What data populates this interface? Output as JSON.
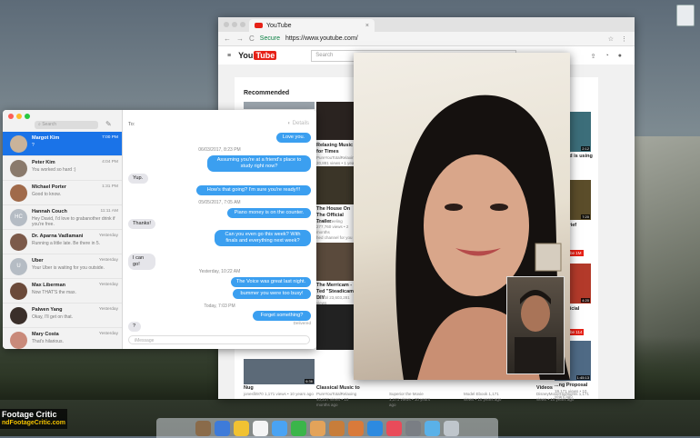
{
  "browser": {
    "tab_title": "YouTube",
    "tab_close": "×",
    "secure_label": "Secure",
    "url": "https://www.youtube.com/",
    "nav_back": "←",
    "nav_forward": "→",
    "nav_reload": "C",
    "star": "☆",
    "menu": "⋮"
  },
  "youtube": {
    "logo_you": "You",
    "logo_tube": "Tube",
    "menu": "≡",
    "search_placeholder": "Search",
    "section_title": "Recommended",
    "videos": [
      {
        "title": "Relaxing Music for Times",
        "meta": "PureYouTotalRelaxing 20,881 views • 1 year ago",
        "duration": ""
      },
      {
        "title": "The House On The Official Trailer",
        "meta": "Austin Keeling 277,760 views • 2 months",
        "duration": ""
      },
      {
        "title": "The Merricam - Ted \"Steadicam\" DIY",
        "meta": "Rambl 23,603,281 views",
        "duration": ""
      },
      {
        "title": "Nug",
        "meta": "jonesfit970 1,171 views • 10 years ago",
        "duration": "6:36"
      },
      {
        "title": "Classical Music to",
        "meta": "PureYouTotalRelaxing 40,237 views • 10 months ago",
        "duration": ""
      },
      {
        "title": "",
        "meta": "Superior the Movie 1,171 views • 10 years ago",
        "duration": ""
      },
      {
        "title": "",
        "meta": "Model Ebook 1,171 views • 10 years ago",
        "duration": ""
      },
      {
        "title": "Videos",
        "meta": "DisneyMovieHighlights 1,171 views • 10 years ago",
        "duration": ""
      },
      {
        "title": "Proposal",
        "meta": "19,171 views • 10 years ago",
        "duration": "1:45:13"
      }
    ],
    "side_titles": [
      "...ur kid is using",
      "...of Grief",
      "...\" Official",
      "...ng Proposal"
    ],
    "side_durations": [
      "2:12",
      "7:20",
      "4:20"
    ],
    "subscribe_label": "Subscribe",
    "subscribe_count_1": "1M",
    "subscribe_count_2": "114",
    "channel_note": "hed channel for you"
  },
  "messages": {
    "search_placeholder": "Search",
    "compose_icon": "✎",
    "to_label": "To:",
    "input_placeholder": "iMessage",
    "conversations": [
      {
        "name": "Margot Kim",
        "time": "7:00 PM",
        "preview": "?",
        "initials": ""
      },
      {
        "name": "Peter Kim",
        "time": "4:04 PM",
        "preview": "You worked so hard :)",
        "initials": ""
      },
      {
        "name": "Michael Porter",
        "time": "1:31 PM",
        "preview": "Good to know.",
        "initials": ""
      },
      {
        "name": "Hannah Couch",
        "time": "11:11 AM",
        "preview": "Hey David, I'd love to grabanother drink if you're free.",
        "initials": "HC"
      },
      {
        "name": "Dr. Aparna Vadlamani",
        "time": "Yesterday",
        "preview": "Running a little late. Be there in 5.",
        "initials": ""
      },
      {
        "name": "Uber",
        "time": "Yesterday",
        "preview": "Your Uber is waiting for you outside.",
        "initials": "U"
      },
      {
        "name": "Max Liberman",
        "time": "Yesterday",
        "preview": "Now THAT'S the max.",
        "initials": ""
      },
      {
        "name": "Palwen Yang",
        "time": "Yesterday",
        "preview": "Okay, I'll get on that.",
        "initials": ""
      },
      {
        "name": "Mary Costa",
        "time": "Yesterday",
        "preview": "That's hilarious.",
        "initials": ""
      }
    ],
    "thread": [
      {
        "kind": "out",
        "text": "Love you."
      },
      {
        "kind": "ts",
        "text": "06/03/2017, 8:23 PM"
      },
      {
        "kind": "out",
        "text": "Assuming you're at a friend's place to study right now?"
      },
      {
        "kind": "in",
        "text": "Yup."
      },
      {
        "kind": "out",
        "text": "How's that going? I'm sure you're ready!!!"
      },
      {
        "kind": "ts",
        "text": "05/05/2017, 7:05 AM"
      },
      {
        "kind": "out",
        "text": "Piano money is on the counter."
      },
      {
        "kind": "in",
        "text": "Thanks!"
      },
      {
        "kind": "out",
        "text": "Can you even go this week? With finals and everything next week?"
      },
      {
        "kind": "in",
        "text": "I can go!"
      },
      {
        "kind": "ts",
        "text": "Yesterday, 10:22 AM"
      },
      {
        "kind": "out",
        "text": "The Voice was great last night."
      },
      {
        "kind": "out",
        "text": "bummer you were too busy!"
      },
      {
        "kind": "ts",
        "text": "Today, 7:03 PM"
      },
      {
        "kind": "out",
        "text": "Forget something?"
      },
      {
        "kind": "delivered",
        "text": "Delivered"
      },
      {
        "kind": "in",
        "text": "?"
      }
    ],
    "details_label": "Details"
  },
  "watermark": {
    "line1": "Footage Critic",
    "line2": "ndFootageCritic.com"
  },
  "colors": {
    "imessage_blue": "#3b9ff0",
    "selected_blue": "#1a73e8",
    "youtube_red": "#e62117"
  }
}
